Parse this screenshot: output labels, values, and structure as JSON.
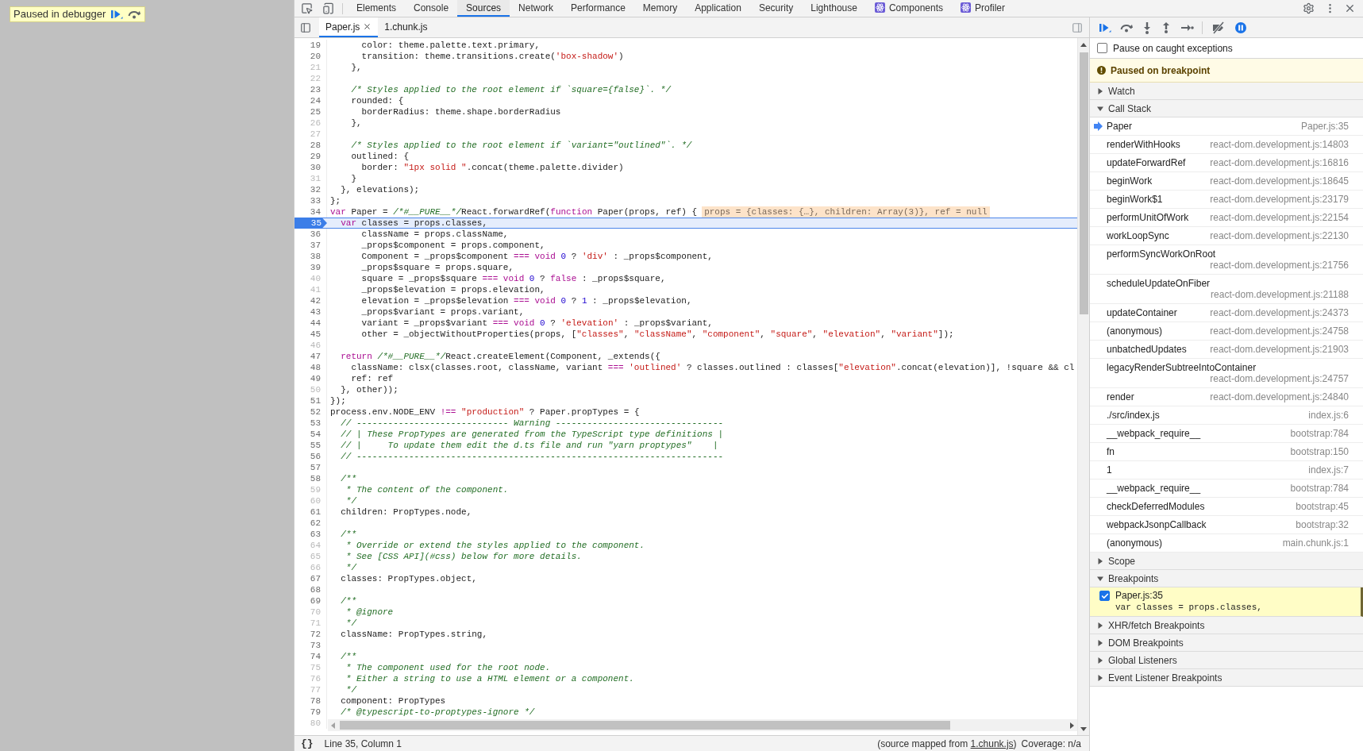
{
  "debugger_overlay": {
    "label": "Paused in debugger"
  },
  "panel_tabs": [
    {
      "label": "Elements",
      "selected": false,
      "kind": "builtin"
    },
    {
      "label": "Console",
      "selected": false,
      "kind": "builtin"
    },
    {
      "label": "Sources",
      "selected": true,
      "kind": "builtin"
    },
    {
      "label": "Network",
      "selected": false,
      "kind": "builtin"
    },
    {
      "label": "Performance",
      "selected": false,
      "kind": "builtin"
    },
    {
      "label": "Memory",
      "selected": false,
      "kind": "builtin"
    },
    {
      "label": "Application",
      "selected": false,
      "kind": "builtin"
    },
    {
      "label": "Security",
      "selected": false,
      "kind": "builtin"
    },
    {
      "label": "Lighthouse",
      "selected": false,
      "kind": "builtin"
    },
    {
      "label": "Components",
      "selected": false,
      "kind": "extension"
    },
    {
      "label": "Profiler",
      "selected": false,
      "kind": "extension"
    }
  ],
  "file_tabs": [
    {
      "label": "Paper.js",
      "selected": true,
      "closable": true
    },
    {
      "label": "1.chunk.js",
      "selected": false,
      "closable": false
    }
  ],
  "code": {
    "lines": [
      {
        "number": "19",
        "muted": false,
        "selected": false,
        "tokens": [
          {
            "kind": "plain",
            "text": "      color: theme.palette.text.primary,"
          }
        ]
      },
      {
        "number": "20",
        "muted": false,
        "selected": false,
        "tokens": [
          {
            "kind": "plain",
            "text": "      transition: theme.transitions.create("
          },
          {
            "kind": "string",
            "text": "'box-shadow'"
          },
          {
            "kind": "plain",
            "text": ")"
          }
        ]
      },
      {
        "number": "21",
        "muted": true,
        "selected": false,
        "tokens": [
          {
            "kind": "plain",
            "text": "    },"
          }
        ]
      },
      {
        "number": "22",
        "muted": true,
        "selected": false
      },
      {
        "number": "23",
        "muted": false,
        "selected": false,
        "tokens": [
          {
            "kind": "comment",
            "text": "    /* Styles applied to the root element if `square={false}`. */"
          }
        ]
      },
      {
        "number": "24",
        "muted": false,
        "selected": false,
        "tokens": [
          {
            "kind": "plain",
            "text": "    rounded: {"
          }
        ]
      },
      {
        "number": "25",
        "muted": false,
        "selected": false,
        "tokens": [
          {
            "kind": "plain",
            "text": "      borderRadius: theme.shape.borderRadius"
          }
        ]
      },
      {
        "number": "26",
        "muted": true,
        "selected": false,
        "tokens": [
          {
            "kind": "plain",
            "text": "    },"
          }
        ]
      },
      {
        "number": "27",
        "muted": true,
        "selected": false
      },
      {
        "number": "28",
        "muted": false,
        "selected": false,
        "tokens": [
          {
            "kind": "comment",
            "text": "    /* Styles applied to the root element if `variant=\"outlined\"`. */"
          }
        ]
      },
      {
        "number": "29",
        "muted": false,
        "selected": false,
        "tokens": [
          {
            "kind": "plain",
            "text": "    outlined: {"
          }
        ]
      },
      {
        "number": "30",
        "muted": false,
        "selected": false,
        "tokens": [
          {
            "kind": "plain",
            "text": "      border: "
          },
          {
            "kind": "string",
            "text": "\"1px solid \""
          },
          {
            "kind": "plain",
            "text": ".concat(theme.palette.divider)"
          }
        ]
      },
      {
        "number": "31",
        "muted": true,
        "selected": false,
        "tokens": [
          {
            "kind": "plain",
            "text": "    }"
          }
        ]
      },
      {
        "number": "32",
        "muted": false,
        "selected": false,
        "tokens": [
          {
            "kind": "plain",
            "text": "  }, elevations);"
          }
        ]
      },
      {
        "number": "33",
        "muted": false,
        "selected": false,
        "tokens": [
          {
            "kind": "plain",
            "text": "};"
          }
        ]
      },
      {
        "number": "34",
        "muted": false,
        "selected": false,
        "tokens": [
          {
            "kind": "keyword",
            "text": "var"
          },
          {
            "kind": "plain",
            "text": " Paper = "
          },
          {
            "kind": "comment",
            "text": "/*#__PURE__*/"
          },
          {
            "kind": "plain",
            "text": "React.forwardRef("
          },
          {
            "kind": "keyword",
            "text": "function"
          },
          {
            "kind": "plain",
            "text": " Paper(props, ref) {"
          }
        ],
        "inline_value": "props = {classes: {…}, children: Array(3)}, ref = null"
      },
      {
        "number": "35",
        "muted": false,
        "selected": true,
        "tokens": [
          {
            "kind": "keyword",
            "text": "  var"
          },
          {
            "kind": "plain",
            "text": " classes = props.classes,"
          }
        ]
      },
      {
        "number": "36",
        "muted": false,
        "selected": false,
        "tokens": [
          {
            "kind": "plain",
            "text": "      className = props.className,"
          }
        ]
      },
      {
        "number": "37",
        "muted": false,
        "selected": false,
        "tokens": [
          {
            "kind": "plain",
            "text": "      _props$component = props.component,"
          }
        ]
      },
      {
        "number": "38",
        "muted": false,
        "selected": false,
        "tokens": [
          {
            "kind": "plain",
            "text": "      Component = _props$component "
          },
          {
            "kind": "keyword",
            "text": "=== void"
          },
          {
            "kind": "number",
            "text": " 0"
          },
          {
            "kind": "plain",
            "text": " ? "
          },
          {
            "kind": "string",
            "text": "'div'"
          },
          {
            "kind": "plain",
            "text": " : _props$component,"
          }
        ]
      },
      {
        "number": "39",
        "muted": false,
        "selected": false,
        "tokens": [
          {
            "kind": "plain",
            "text": "      _props$square = props.square,"
          }
        ]
      },
      {
        "number": "40",
        "muted": true,
        "selected": false,
        "tokens": [
          {
            "kind": "plain",
            "text": "      square = _props$square "
          },
          {
            "kind": "keyword",
            "text": "=== void"
          },
          {
            "kind": "number",
            "text": " 0"
          },
          {
            "kind": "plain",
            "text": " ? "
          },
          {
            "kind": "keyword",
            "text": "false"
          },
          {
            "kind": "plain",
            "text": " : _props$square,"
          }
        ]
      },
      {
        "number": "41",
        "muted": true,
        "selected": false,
        "tokens": [
          {
            "kind": "plain",
            "text": "      _props$elevation = props.elevation,"
          }
        ]
      },
      {
        "number": "42",
        "muted": false,
        "selected": false,
        "tokens": [
          {
            "kind": "plain",
            "text": "      elevation = _props$elevation "
          },
          {
            "kind": "keyword",
            "text": "=== void"
          },
          {
            "kind": "number",
            "text": " 0"
          },
          {
            "kind": "plain",
            "text": " ? "
          },
          {
            "kind": "number",
            "text": "1"
          },
          {
            "kind": "plain",
            "text": " : _props$elevation,"
          }
        ]
      },
      {
        "number": "43",
        "muted": false,
        "selected": false,
        "tokens": [
          {
            "kind": "plain",
            "text": "      _props$variant = props.variant,"
          }
        ]
      },
      {
        "number": "44",
        "muted": false,
        "selected": false,
        "tokens": [
          {
            "kind": "plain",
            "text": "      variant = _props$variant "
          },
          {
            "kind": "keyword",
            "text": "=== void"
          },
          {
            "kind": "number",
            "text": " 0"
          },
          {
            "kind": "plain",
            "text": " ? "
          },
          {
            "kind": "string",
            "text": "'elevation'"
          },
          {
            "kind": "plain",
            "text": " : _props$variant,"
          }
        ]
      },
      {
        "number": "45",
        "muted": false,
        "selected": false,
        "tokens": [
          {
            "kind": "plain",
            "text": "      other = _objectWithoutProperties(props, ["
          },
          {
            "kind": "string",
            "text": "\"classes\""
          },
          {
            "kind": "plain",
            "text": ", "
          },
          {
            "kind": "string",
            "text": "\"className\""
          },
          {
            "kind": "plain",
            "text": ", "
          },
          {
            "kind": "string",
            "text": "\"component\""
          },
          {
            "kind": "plain",
            "text": ", "
          },
          {
            "kind": "string",
            "text": "\"square\""
          },
          {
            "kind": "plain",
            "text": ", "
          },
          {
            "kind": "string",
            "text": "\"elevation\""
          },
          {
            "kind": "plain",
            "text": ", "
          },
          {
            "kind": "string",
            "text": "\"variant\""
          },
          {
            "kind": "plain",
            "text": "]);"
          }
        ]
      },
      {
        "number": "46",
        "muted": true,
        "selected": false
      },
      {
        "number": "47",
        "muted": false,
        "selected": false,
        "tokens": [
          {
            "kind": "keyword",
            "text": "  return"
          },
          {
            "kind": "comment",
            "text": " /*#__PURE__*/"
          },
          {
            "kind": "plain",
            "text": "React.createElement(Component, _extends({"
          }
        ]
      },
      {
        "number": "48",
        "muted": false,
        "selected": false,
        "tokens": [
          {
            "kind": "plain",
            "text": "    className: clsx(classes.root, className, variant "
          },
          {
            "kind": "keyword",
            "text": "==="
          },
          {
            "kind": "string",
            "text": " 'outlined'"
          },
          {
            "kind": "plain",
            "text": " ? classes.outlined : classes["
          },
          {
            "kind": "string",
            "text": "\"elevation\""
          },
          {
            "kind": "plain",
            "text": ".concat(elevation)], !square && cl"
          }
        ]
      },
      {
        "number": "49",
        "muted": false,
        "selected": false,
        "tokens": [
          {
            "kind": "plain",
            "text": "    ref: ref"
          }
        ]
      },
      {
        "number": "50",
        "muted": true,
        "selected": false,
        "tokens": [
          {
            "kind": "plain",
            "text": "  }, other));"
          }
        ]
      },
      {
        "number": "51",
        "muted": false,
        "selected": false,
        "tokens": [
          {
            "kind": "plain",
            "text": "});"
          }
        ]
      },
      {
        "number": "52",
        "muted": false,
        "selected": false,
        "tokens": [
          {
            "kind": "plain",
            "text": "process.env.NODE_ENV "
          },
          {
            "kind": "keyword",
            "text": "!=="
          },
          {
            "kind": "string",
            "text": " \"production\""
          },
          {
            "kind": "plain",
            "text": " ? Paper.propTypes = {"
          }
        ]
      },
      {
        "number": "53",
        "muted": false,
        "selected": false,
        "tokens": [
          {
            "kind": "comment",
            "text": "  // ----------------------------- Warning --------------------------------"
          }
        ]
      },
      {
        "number": "54",
        "muted": false,
        "selected": false,
        "tokens": [
          {
            "kind": "comment",
            "text": "  // | These PropTypes are generated from the TypeScript type definitions |"
          }
        ]
      },
      {
        "number": "55",
        "muted": false,
        "selected": false,
        "tokens": [
          {
            "kind": "comment",
            "text": "  // |     To update them edit the d.ts file and run \"yarn proptypes\"    |"
          }
        ]
      },
      {
        "number": "56",
        "muted": false,
        "selected": false,
        "tokens": [
          {
            "kind": "comment",
            "text": "  // ----------------------------------------------------------------------"
          }
        ]
      },
      {
        "number": "57",
        "muted": false,
        "selected": false
      },
      {
        "number": "58",
        "muted": false,
        "selected": false,
        "tokens": [
          {
            "kind": "comment",
            "text": "  /**"
          }
        ]
      },
      {
        "number": "59",
        "muted": true,
        "selected": false,
        "tokens": [
          {
            "kind": "comment",
            "text": "   * The content of the component."
          }
        ]
      },
      {
        "number": "60",
        "muted": true,
        "selected": false,
        "tokens": [
          {
            "kind": "comment",
            "text": "   */"
          }
        ]
      },
      {
        "number": "61",
        "muted": false,
        "selected": false,
        "tokens": [
          {
            "kind": "plain",
            "text": "  children: PropTypes.node,"
          }
        ]
      },
      {
        "number": "62",
        "muted": false,
        "selected": false
      },
      {
        "number": "63",
        "muted": false,
        "selected": false,
        "tokens": [
          {
            "kind": "comment",
            "text": "  /**"
          }
        ]
      },
      {
        "number": "64",
        "muted": true,
        "selected": false,
        "tokens": [
          {
            "kind": "comment",
            "text": "   * Override or extend the styles applied to the component."
          }
        ]
      },
      {
        "number": "65",
        "muted": true,
        "selected": false,
        "tokens": [
          {
            "kind": "comment",
            "text": "   * See [CSS API](#css) below for more details."
          }
        ]
      },
      {
        "number": "66",
        "muted": true,
        "selected": false,
        "tokens": [
          {
            "kind": "comment",
            "text": "   */"
          }
        ]
      },
      {
        "number": "67",
        "muted": false,
        "selected": false,
        "tokens": [
          {
            "kind": "plain",
            "text": "  classes: PropTypes.object,"
          }
        ]
      },
      {
        "number": "68",
        "muted": false,
        "selected": false
      },
      {
        "number": "69",
        "muted": false,
        "selected": false,
        "tokens": [
          {
            "kind": "comment",
            "text": "  /**"
          }
        ]
      },
      {
        "number": "70",
        "muted": true,
        "selected": false,
        "tokens": [
          {
            "kind": "comment",
            "text": "   * @ignore"
          }
        ]
      },
      {
        "number": "71",
        "muted": true,
        "selected": false,
        "tokens": [
          {
            "kind": "comment",
            "text": "   */"
          }
        ]
      },
      {
        "number": "72",
        "muted": false,
        "selected": false,
        "tokens": [
          {
            "kind": "plain",
            "text": "  className: PropTypes.string,"
          }
        ]
      },
      {
        "number": "73",
        "muted": false,
        "selected": false
      },
      {
        "number": "74",
        "muted": false,
        "selected": false,
        "tokens": [
          {
            "kind": "comment",
            "text": "  /**"
          }
        ]
      },
      {
        "number": "75",
        "muted": true,
        "selected": false,
        "tokens": [
          {
            "kind": "comment",
            "text": "   * The component used for the root node."
          }
        ]
      },
      {
        "number": "76",
        "muted": true,
        "selected": false,
        "tokens": [
          {
            "kind": "comment",
            "text": "   * Either a string to use a HTML element or a component."
          }
        ]
      },
      {
        "number": "77",
        "muted": true,
        "selected": false,
        "tokens": [
          {
            "kind": "comment",
            "text": "   */"
          }
        ]
      },
      {
        "number": "78",
        "muted": false,
        "selected": false,
        "tokens": [
          {
            "kind": "plain",
            "text": "  component: PropTypes"
          }
        ]
      },
      {
        "number": "79",
        "muted": false,
        "selected": false,
        "tokens": [
          {
            "kind": "comment",
            "text": "  /* @typescript-to-proptypes-ignore */"
          }
        ]
      },
      {
        "number": "80",
        "muted": true,
        "selected": false
      }
    ]
  },
  "status_bar": {
    "pretty_print": "{}",
    "position": "Line 35, Column 1",
    "source_prefix": "(source mapped from ",
    "source_link": "1.chunk.js",
    "source_suffix": ")",
    "coverage": "Coverage: n/a"
  },
  "sidebar": {
    "pause_on_exceptions_active": true,
    "pause_on_caught": {
      "label": "Pause on caught exceptions",
      "checked": false
    },
    "paused_message": "Paused on breakpoint",
    "sections": [
      {
        "title": "Watch",
        "expanded": false
      },
      {
        "title": "Call Stack",
        "expanded": true,
        "frames": [
          {
            "name": "Paper",
            "location": "Paper.js:35",
            "selected": true
          },
          {
            "name": "renderWithHooks",
            "location": "react-dom.development.js:14803",
            "selected": false
          },
          {
            "name": "updateForwardRef",
            "location": "react-dom.development.js:16816",
            "selected": false
          },
          {
            "name": "beginWork",
            "location": "react-dom.development.js:18645",
            "selected": false
          },
          {
            "name": "beginWork$1",
            "location": "react-dom.development.js:23179",
            "selected": false
          },
          {
            "name": "performUnitOfWork",
            "location": "react-dom.development.js:22154",
            "selected": false
          },
          {
            "name": "workLoopSync",
            "location": "react-dom.development.js:22130",
            "selected": false
          },
          {
            "name": "performSyncWorkOnRoot",
            "location": "react-dom.development.js:21756",
            "selected": false
          },
          {
            "name": "scheduleUpdateOnFiber",
            "location": "react-dom.development.js:21188",
            "selected": false
          },
          {
            "name": "updateContainer",
            "location": "react-dom.development.js:24373",
            "selected": false
          },
          {
            "name": "(anonymous)",
            "location": "react-dom.development.js:24758",
            "selected": false
          },
          {
            "name": "unbatchedUpdates",
            "location": "react-dom.development.js:21903",
            "selected": false
          },
          {
            "name": "legacyRenderSubtreeIntoContainer",
            "location": "react-dom.development.js:24757",
            "selected": false
          },
          {
            "name": "render",
            "location": "react-dom.development.js:24840",
            "selected": false
          },
          {
            "name": "./src/index.js",
            "location": "index.js:6",
            "selected": false
          },
          {
            "name": "__webpack_require__",
            "location": "bootstrap:784",
            "selected": false
          },
          {
            "name": "fn",
            "location": "bootstrap:150",
            "selected": false
          },
          {
            "name": "1",
            "location": "index.js:7",
            "selected": false
          },
          {
            "name": "__webpack_require__",
            "location": "bootstrap:784",
            "selected": false
          },
          {
            "name": "checkDeferredModules",
            "location": "bootstrap:45",
            "selected": false
          },
          {
            "name": "webpackJsonpCallback",
            "location": "bootstrap:32",
            "selected": false
          },
          {
            "name": "(anonymous)",
            "location": "main.chunk.js:1",
            "selected": false
          }
        ]
      },
      {
        "title": "Scope",
        "expanded": false
      },
      {
        "title": "Breakpoints",
        "expanded": true,
        "breakpoints": [
          {
            "location": "Paper.js:35",
            "code": "var classes = props.classes,",
            "checked": true
          }
        ]
      },
      {
        "title": "XHR/fetch Breakpoints",
        "expanded": false
      },
      {
        "title": "DOM Breakpoints",
        "expanded": false
      },
      {
        "title": "Global Listeners",
        "expanded": false
      },
      {
        "title": "Event Listener Breakpoints",
        "expanded": false
      }
    ]
  }
}
